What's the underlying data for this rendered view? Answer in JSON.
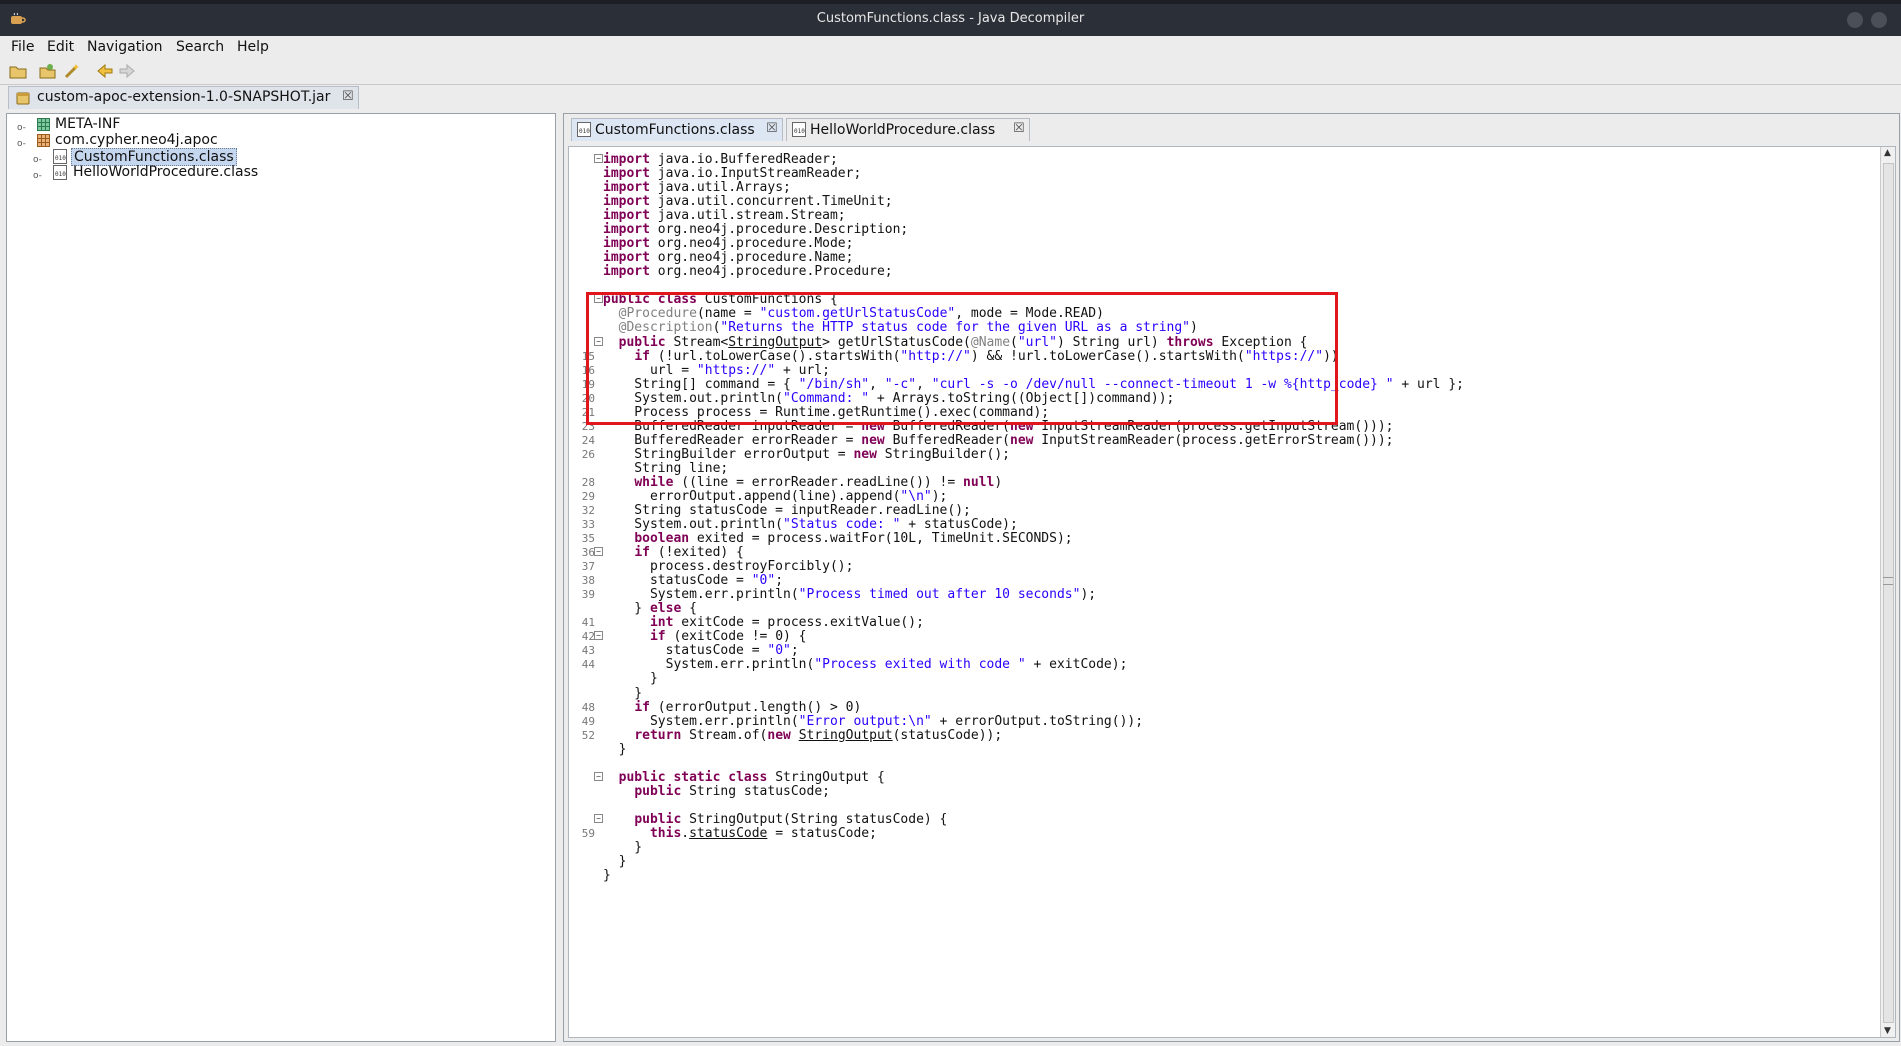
{
  "window": {
    "title": "CustomFunctions.class - Java Decompiler"
  },
  "menu": [
    "File",
    "Edit",
    "Navigation",
    "Search",
    "Help"
  ],
  "toolbar": {
    "icons": [
      "open-folder-icon",
      "open-type-icon",
      "wand-icon",
      "back-arrow-icon",
      "forward-arrow-icon"
    ]
  },
  "jar_tab": {
    "label": "custom-apoc-extension-1.0-SNAPSHOT.jar",
    "close": "☒"
  },
  "tree": [
    {
      "label": "META-INF",
      "level": 0
    },
    {
      "label": "com.cypher.neo4j.apoc",
      "level": 0
    },
    {
      "label": "CustomFunctions.class",
      "level": 1,
      "selected": true
    },
    {
      "label": "HelloWorldProcedure.class",
      "level": 1
    }
  ],
  "file_tabs": [
    {
      "label": "CustomFunctions.class",
      "active": true,
      "close": "☒"
    },
    {
      "label": "HelloWorldProcedure.class",
      "active": false,
      "close": "☒"
    }
  ],
  "code": [
    {
      "ln": "",
      "fold": true,
      "text": "import java.io.BufferedReader;"
    },
    {
      "ln": "",
      "text": "import java.io.InputStreamReader;"
    },
    {
      "ln": "",
      "text": "import java.util.Arrays;"
    },
    {
      "ln": "",
      "text": "import java.util.concurrent.TimeUnit;"
    },
    {
      "ln": "",
      "text": "import java.util.stream.Stream;"
    },
    {
      "ln": "",
      "text": "import org.neo4j.procedure.Description;"
    },
    {
      "ln": "",
      "text": "import org.neo4j.procedure.Mode;"
    },
    {
      "ln": "",
      "text": "import org.neo4j.procedure.Name;"
    },
    {
      "ln": "",
      "text": "import org.neo4j.procedure.Procedure;"
    },
    {
      "ln": "",
      "text": ""
    },
    {
      "ln": "",
      "fold": true,
      "text": "public class CustomFunctions {"
    },
    {
      "ln": "",
      "text": "  @Procedure(name = \"custom.getUrlStatusCode\", mode = Mode.READ)"
    },
    {
      "ln": "",
      "text": "  @Description(\"Returns the HTTP status code for the given URL as a string\")"
    },
    {
      "ln": "",
      "fold": true,
      "text": "  public Stream<StringOutput> getUrlStatusCode(@Name(\"url\") String url) throws Exception {"
    },
    {
      "ln": "15",
      "text": "    if (!url.toLowerCase().startsWith(\"http://\") && !url.toLowerCase().startsWith(\"https://\"))"
    },
    {
      "ln": "16",
      "text": "      url = \"https://\" + url;"
    },
    {
      "ln": "19",
      "text": "    String[] command = { \"/bin/sh\", \"-c\", \"curl -s -o /dev/null --connect-timeout 1 -w %{http_code} \" + url };"
    },
    {
      "ln": "20",
      "text": "    System.out.println(\"Command: \" + Arrays.toString((Object[])command));"
    },
    {
      "ln": "21",
      "text": "    Process process = Runtime.getRuntime().exec(command);"
    },
    {
      "ln": "23",
      "text": "    BufferedReader inputReader = new BufferedReader(new InputStreamReader(process.getInputStream()));"
    },
    {
      "ln": "24",
      "text": "    BufferedReader errorReader = new BufferedReader(new InputStreamReader(process.getErrorStream()));"
    },
    {
      "ln": "26",
      "text": "    StringBuilder errorOutput = new StringBuilder();"
    },
    {
      "ln": "",
      "text": "    String line;"
    },
    {
      "ln": "28",
      "text": "    while ((line = errorReader.readLine()) != null)"
    },
    {
      "ln": "29",
      "text": "      errorOutput.append(line).append(\"\\n\");"
    },
    {
      "ln": "32",
      "text": "    String statusCode = inputReader.readLine();"
    },
    {
      "ln": "33",
      "text": "    System.out.println(\"Status code: \" + statusCode);"
    },
    {
      "ln": "35",
      "text": "    boolean exited = process.waitFor(10L, TimeUnit.SECONDS);"
    },
    {
      "ln": "36",
      "fold": true,
      "text": "    if (!exited) {"
    },
    {
      "ln": "37",
      "text": "      process.destroyForcibly();"
    },
    {
      "ln": "38",
      "text": "      statusCode = \"0\";"
    },
    {
      "ln": "39",
      "text": "      System.err.println(\"Process timed out after 10 seconds\");"
    },
    {
      "ln": "",
      "text": "    } else {"
    },
    {
      "ln": "41",
      "text": "      int exitCode = process.exitValue();"
    },
    {
      "ln": "42",
      "fold": true,
      "text": "      if (exitCode != 0) {"
    },
    {
      "ln": "43",
      "text": "        statusCode = \"0\";"
    },
    {
      "ln": "44",
      "text": "        System.err.println(\"Process exited with code \" + exitCode);"
    },
    {
      "ln": "",
      "text": "      }"
    },
    {
      "ln": "",
      "text": "    }"
    },
    {
      "ln": "48",
      "text": "    if (errorOutput.length() > 0)"
    },
    {
      "ln": "49",
      "text": "      System.err.println(\"Error output:\\n\" + errorOutput.toString());"
    },
    {
      "ln": "52",
      "text": "    return Stream.of(new StringOutput(statusCode));"
    },
    {
      "ln": "",
      "text": "  }"
    },
    {
      "ln": "",
      "text": ""
    },
    {
      "ln": "",
      "fold": true,
      "text": "  public static class StringOutput {"
    },
    {
      "ln": "",
      "text": "    public String statusCode;"
    },
    {
      "ln": "",
      "text": ""
    },
    {
      "ln": "",
      "fold": true,
      "text": "    public StringOutput(String statusCode) {"
    },
    {
      "ln": "59",
      "text": "      this.statusCode = statusCode;"
    },
    {
      "ln": "",
      "text": "    }"
    },
    {
      "ln": "",
      "text": "  }"
    },
    {
      "ln": "",
      "text": "}"
    }
  ],
  "colors": {
    "keyword": "#7f0055",
    "string": "#2a00ff",
    "annotation": "#808080",
    "highlight": "#e0161c"
  }
}
